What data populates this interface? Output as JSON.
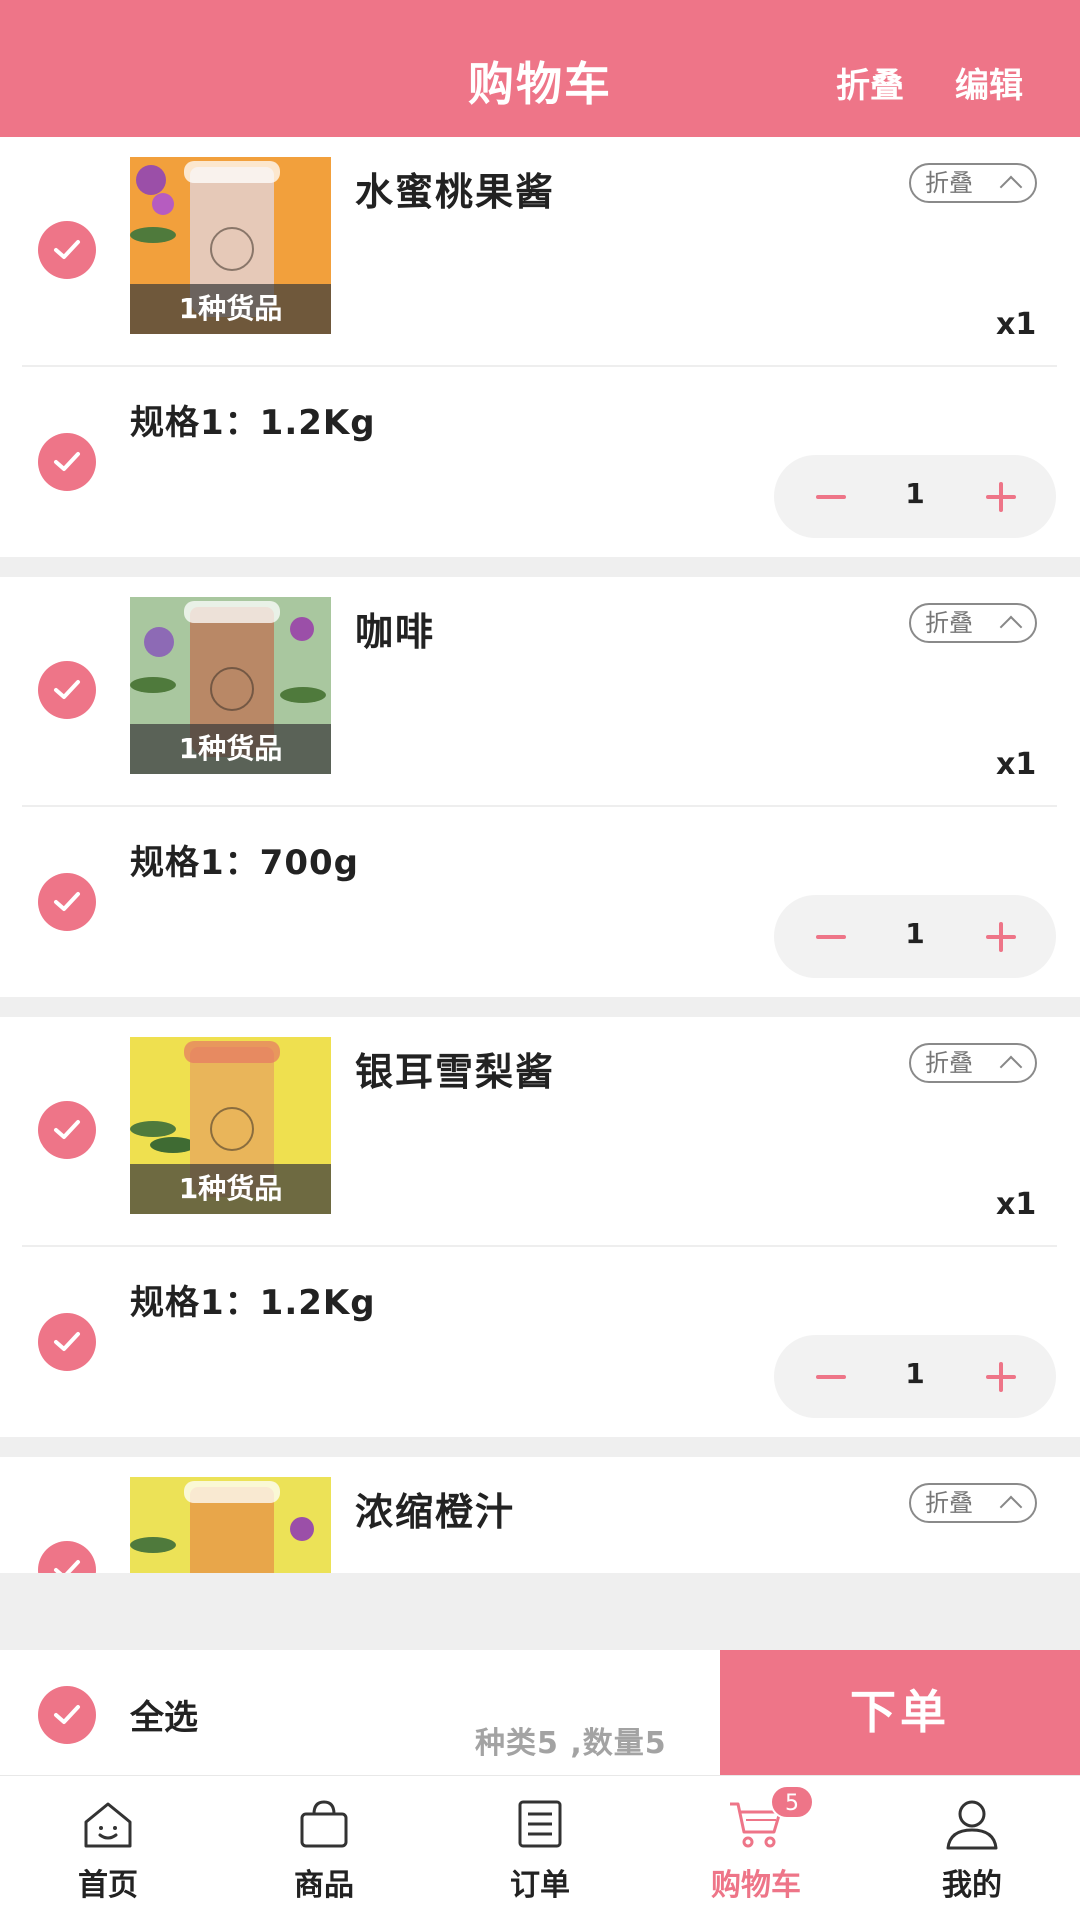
{
  "header": {
    "title": "购物车",
    "fold_label": "折叠",
    "edit_label": "编辑"
  },
  "colors": {
    "accent": "#ee7588",
    "muted": "#a3a3a3",
    "separator": "#efefef"
  },
  "items": [
    {
      "name": "水蜜桃果酱",
      "goods_count": "1种货品",
      "fold_tag": "折叠",
      "qty_label": "x1",
      "spec": "规格1：1.2Kg",
      "quantity": "1",
      "checked": true
    },
    {
      "name": "咖啡",
      "goods_count": "1种货品",
      "fold_tag": "折叠",
      "qty_label": "x1",
      "spec": "规格1：700g",
      "quantity": "1",
      "checked": true
    },
    {
      "name": "银耳雪梨酱",
      "goods_count": "1种货品",
      "fold_tag": "折叠",
      "qty_label": "x1",
      "spec": "规格1：1.2Kg",
      "quantity": "1",
      "checked": true
    },
    {
      "name": "浓缩橙汁",
      "fold_tag": "折叠",
      "checked": true
    }
  ],
  "footer": {
    "select_all_label": "全选",
    "summary": "种类5 ,数量5",
    "order_button": "下单"
  },
  "tabbar": {
    "items": [
      {
        "label": "首页",
        "icon": "home-icon"
      },
      {
        "label": "商品",
        "icon": "bag-icon"
      },
      {
        "label": "订单",
        "icon": "order-icon"
      },
      {
        "label": "购物车",
        "icon": "cart-icon",
        "active": true
      },
      {
        "label": "我的",
        "icon": "user-icon"
      }
    ],
    "cart_badge": "5"
  }
}
